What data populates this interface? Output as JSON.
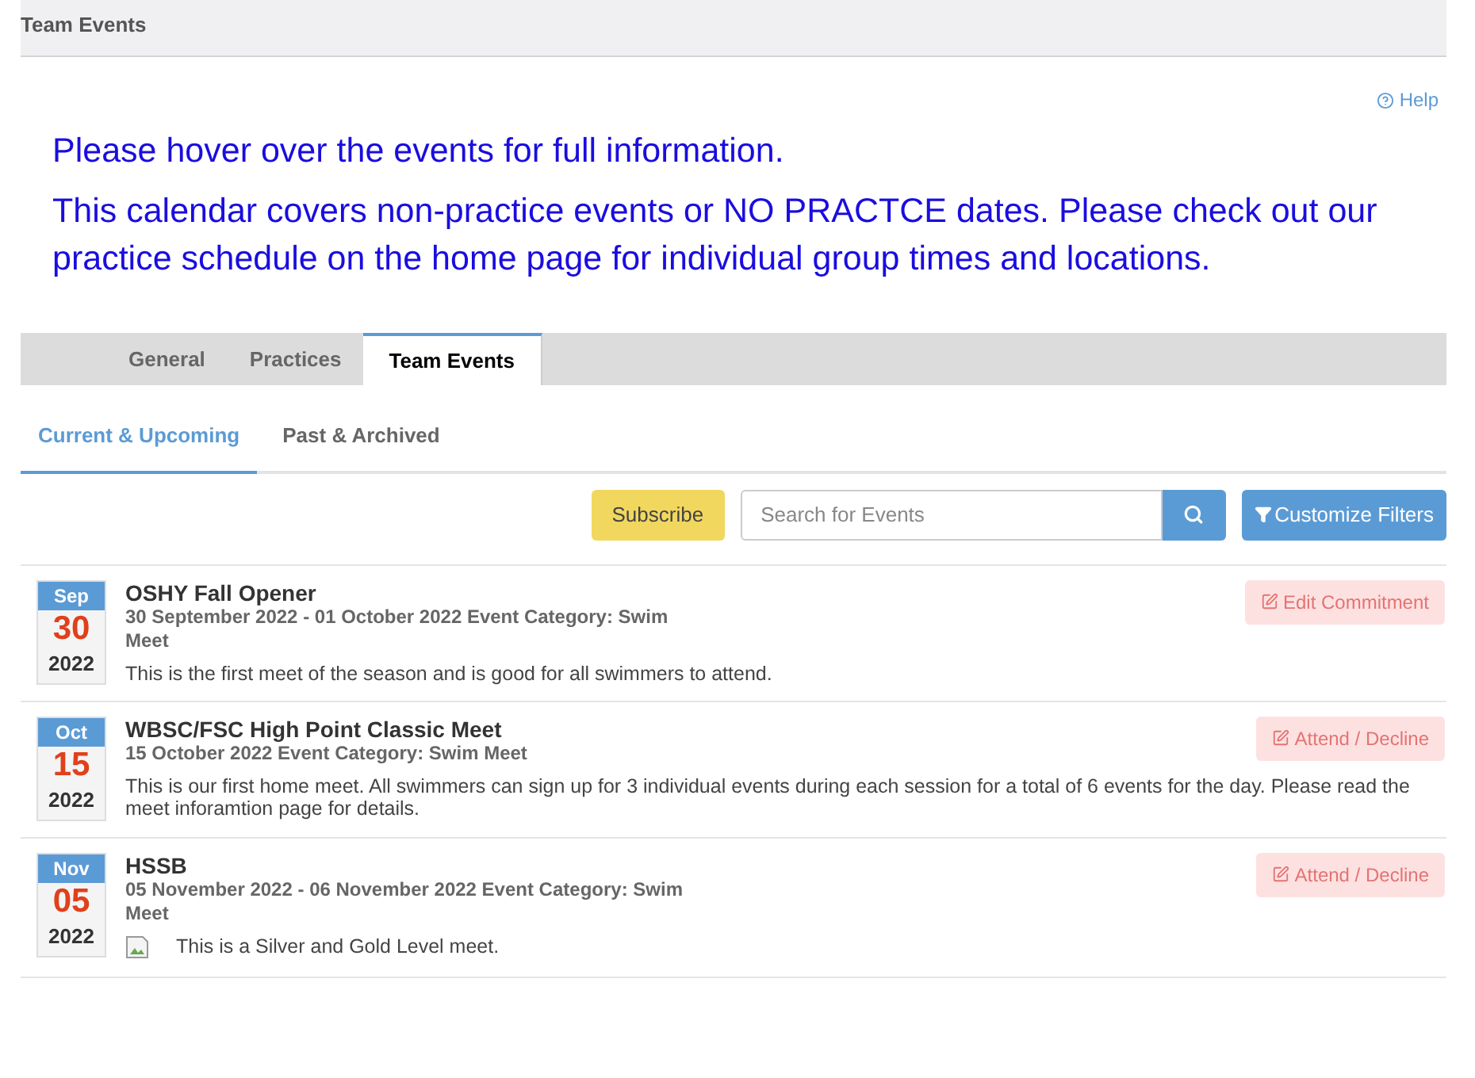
{
  "header": {
    "title": "Team Events"
  },
  "help": "Help",
  "notices": [
    "Please hover over the events for full information.",
    "This calendar covers non-practice events or NO PRACTCE dates.  Please check out our practice schedule on the home page for individual group times and locations."
  ],
  "tabs": [
    {
      "label": "General",
      "selected": false
    },
    {
      "label": "Practices",
      "selected": false
    },
    {
      "label": "Team Events",
      "selected": true
    }
  ],
  "subtabs": [
    {
      "label": "Current & Upcoming",
      "selected": true
    },
    {
      "label": "Past & Archived",
      "selected": false
    }
  ],
  "toolbar": {
    "subscribe": "Subscribe",
    "search": {
      "placeholder": "Search for Events"
    },
    "filters": "Customize Filters"
  },
  "events": [
    {
      "month": "Sep",
      "day": "30",
      "year": "2022",
      "title": "OSHY Fall Opener",
      "meta": "30 September 2022 - 01 October 2022 Event Category: Swim Meet",
      "description": "This is the first meet of the season and is good for all swimmers to attend.",
      "action": "Edit Commitment",
      "has_image": false
    },
    {
      "month": "Oct",
      "day": "15",
      "year": "2022",
      "title": "WBSC/FSC High Point Classic Meet",
      "meta": "15 October 2022 Event Category: Swim Meet",
      "description": "This is our first home meet.   All swimmers can sign up for 3 individual events during each session for a total of 6 events for the day.  Please read the meet inforamtion page for details.",
      "action": "Attend / Decline",
      "has_image": false
    },
    {
      "month": "Nov",
      "day": "05",
      "year": "2022",
      "title": "HSSB",
      "meta": "05 November 2022 - 06 November 2022 Event Category: Swim Meet",
      "description": "This is a Silver and Gold Level meet.",
      "action": "Attend / Decline",
      "has_image": true
    }
  ]
}
